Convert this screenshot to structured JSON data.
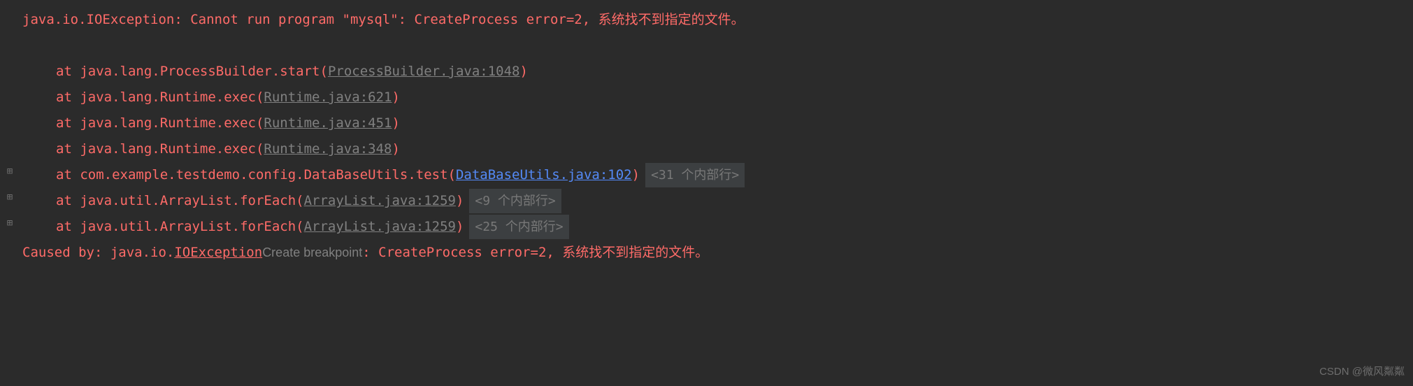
{
  "stacktrace": {
    "exception_line": "java.io.IOException: Cannot run program \"mysql\": CreateProcess error=2, 系统找不到指定的文件。",
    "frames": [
      {
        "prefix": "at java.lang.ProcessBuilder.start(",
        "link": "ProcessBuilder.java:1048",
        "suffix": ")",
        "link_type": "gray",
        "expandable": false,
        "badge": null
      },
      {
        "prefix": "at java.lang.Runtime.exec(",
        "link": "Runtime.java:621",
        "suffix": ")",
        "link_type": "gray",
        "expandable": false,
        "badge": null
      },
      {
        "prefix": "at java.lang.Runtime.exec(",
        "link": "Runtime.java:451",
        "suffix": ")",
        "link_type": "gray",
        "expandable": false,
        "badge": null
      },
      {
        "prefix": "at java.lang.Runtime.exec(",
        "link": "Runtime.java:348",
        "suffix": ")",
        "link_type": "gray",
        "expandable": false,
        "badge": null
      },
      {
        "prefix": "at com.example.testdemo.config.DataBaseUtils.test(",
        "link": "DataBaseUtils.java:102",
        "suffix": ")",
        "link_type": "blue",
        "expandable": true,
        "badge": "<31 个内部行>"
      },
      {
        "prefix": "at java.util.ArrayList.forEach(",
        "link": "ArrayList.java:1259",
        "suffix": ")",
        "link_type": "gray",
        "expandable": true,
        "badge": "<9 个内部行>"
      },
      {
        "prefix": "at java.util.ArrayList.forEach(",
        "link": "ArrayList.java:1259",
        "suffix": ")",
        "link_type": "gray",
        "expandable": true,
        "badge": "<25 个内部行>"
      }
    ],
    "caused_by": {
      "prefix": "Caused by: java.io.",
      "exception_class": "IOException",
      "breakpoint_label": " Create breakpoint ",
      "suffix": ": CreateProcess error=2, 系统找不到指定的文件。"
    }
  },
  "icons": {
    "expand": "⊞"
  },
  "watermark": "CSDN @微风粼粼"
}
